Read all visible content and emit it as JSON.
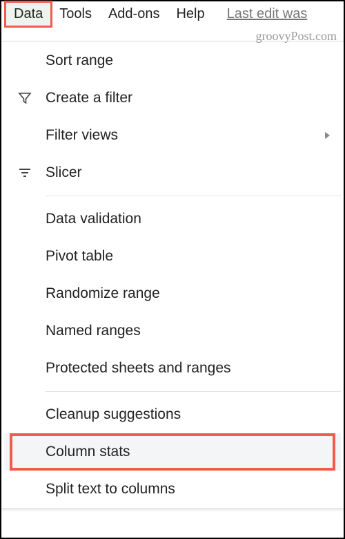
{
  "menubar": {
    "items": [
      {
        "label": "Data",
        "active": true
      },
      {
        "label": "Tools"
      },
      {
        "label": "Add-ons"
      },
      {
        "label": "Help"
      }
    ],
    "last_edit": "Last edit was"
  },
  "watermark": "groovyPost.com",
  "dropdown": {
    "groups": [
      [
        {
          "label": "Sort range",
          "icon": null
        },
        {
          "label": "Create a filter",
          "icon": "filter"
        },
        {
          "label": "Filter views",
          "icon": null,
          "submenu": true
        },
        {
          "label": "Slicer",
          "icon": "slicer"
        }
      ],
      [
        {
          "label": "Data validation",
          "icon": null
        },
        {
          "label": "Pivot table",
          "icon": null
        },
        {
          "label": "Randomize range",
          "icon": null
        },
        {
          "label": "Named ranges",
          "icon": null
        },
        {
          "label": "Protected sheets and ranges",
          "icon": null
        }
      ],
      [
        {
          "label": "Cleanup suggestions",
          "icon": null
        },
        {
          "label": "Column stats",
          "icon": null,
          "highlighted": true,
          "red_outline": true
        },
        {
          "label": "Split text to columns",
          "icon": null
        }
      ]
    ]
  }
}
